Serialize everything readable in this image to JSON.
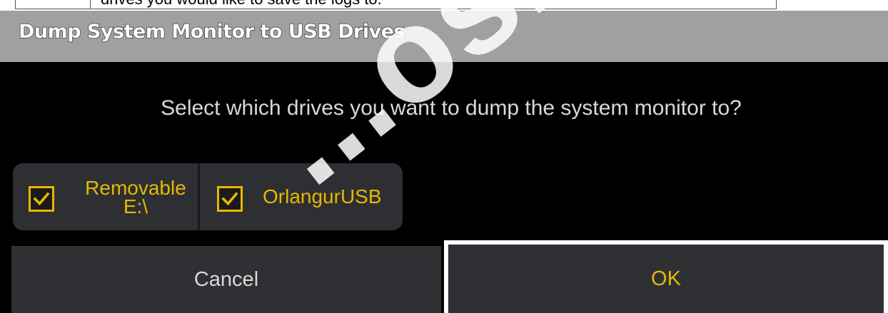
{
  "document": {
    "partial_text": "drives you would like to save the logs to."
  },
  "dialog": {
    "title": "Dump System Monitor to USB Drives",
    "prompt": "Select which drives you want to dump the system monitor to?",
    "drives": [
      {
        "label_line1": "Removable",
        "label_line2": "E:\\",
        "checked": true
      },
      {
        "label": "OrlangurUSB",
        "checked": true
      }
    ],
    "cancel_label": "Cancel",
    "ok_label": "OK"
  },
  "watermark": {
    "text": "...osmendo..."
  },
  "colors": {
    "title_bar": "#a0a0a0",
    "dialog_bg": "#000000",
    "button_bg": "#2f3033",
    "accent_yellow": "#e5b800",
    "text_light": "#d8d8d8"
  },
  "icons": {
    "checkbox_checked": "check-icon"
  }
}
